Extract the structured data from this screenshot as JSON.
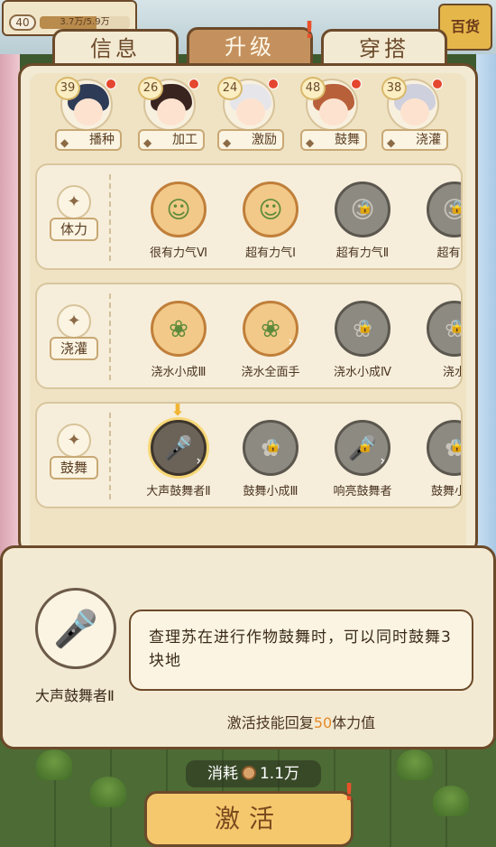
{
  "hud": {
    "level": "40",
    "progress_text": "3.7万/5.9万",
    "progress": 0.63
  },
  "shop_label": "百货",
  "tabs": [
    {
      "label": "信息"
    },
    {
      "label": "升级"
    },
    {
      "label": "穿搭"
    }
  ],
  "alert_mark": "!",
  "characters": [
    {
      "level": "39",
      "role": "播种",
      "icon": "sow-icon",
      "hair": "#2d3b57"
    },
    {
      "level": "26",
      "role": "加工",
      "icon": "megaphone-icon",
      "hair": "#3a2420"
    },
    {
      "level": "24",
      "role": "激励",
      "icon": "encourage-icon",
      "hair": "#e6e6ea"
    },
    {
      "level": "48",
      "role": "鼓舞",
      "icon": "microphone-icon",
      "hair": "#b8603a"
    },
    {
      "level": "38",
      "role": "浇灌",
      "icon": "watering-can-icon",
      "hair": "#cfd0dd"
    }
  ],
  "skill_rows": [
    {
      "category": "体力",
      "category_icon": "strength-icon",
      "skills": [
        {
          "name": "很有力气Ⅵ",
          "state": "active",
          "glyph": "☺"
        },
        {
          "name": "超有力气Ⅰ",
          "state": "active",
          "glyph": "☺"
        },
        {
          "name": "超有力气Ⅱ",
          "state": "locked",
          "glyph": "☺"
        },
        {
          "name": "超有力",
          "state": "locked",
          "glyph": "☺"
        }
      ]
    },
    {
      "category": "浇灌",
      "category_icon": "watering-can-icon",
      "skills": [
        {
          "name": "浇水小成Ⅲ",
          "state": "active",
          "glyph": "❀"
        },
        {
          "name": "浇水全面手",
          "state": "active",
          "glyph": "❀",
          "mult": "×4"
        },
        {
          "name": "浇水小成Ⅳ",
          "state": "locked",
          "glyph": "❀"
        },
        {
          "name": "浇水",
          "state": "locked",
          "glyph": "❀"
        }
      ]
    },
    {
      "category": "鼓舞",
      "category_icon": "microphone-icon",
      "skills": [
        {
          "name": "大声鼓舞者Ⅱ",
          "state": "selected",
          "glyph": "🎤",
          "mult": "×3"
        },
        {
          "name": "鼓舞小成Ⅲ",
          "state": "locked",
          "glyph": "✿"
        },
        {
          "name": "响亮鼓舞者",
          "state": "locked",
          "glyph": "🎤",
          "mult": "×4"
        },
        {
          "name": "鼓舞小成",
          "state": "locked",
          "glyph": "✿"
        }
      ]
    }
  ],
  "detail": {
    "name": "大声鼓舞者Ⅱ",
    "description": "查理苏在进行作物鼓舞时，可以同时鼓舞3块地",
    "restore_prefix": "激活技能回复",
    "restore_value": "50",
    "restore_suffix": "体力值"
  },
  "cost": {
    "label": "消耗",
    "amount": "1.1万"
  },
  "activate_label": "激活",
  "colors": {
    "accent": "#f5c86e",
    "border": "#6b4a2a",
    "highlight": "#e48a2a"
  }
}
